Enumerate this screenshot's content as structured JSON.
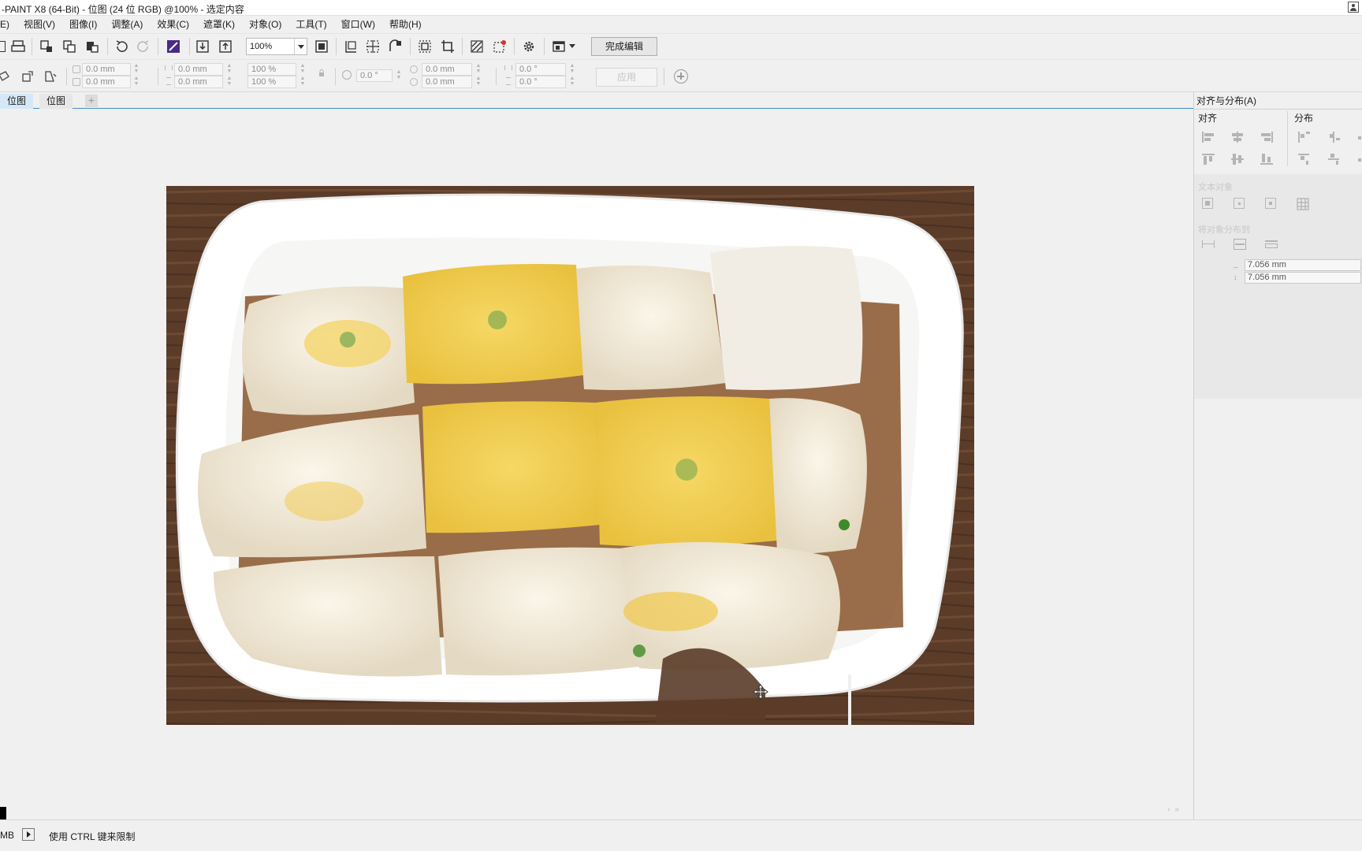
{
  "window": {
    "title": "-PAINT X8 (64-Bit) - 位图 (24 位 RGB) @100% - 选定内容"
  },
  "menu": [
    {
      "label": "E)"
    },
    {
      "label": "视图(V)"
    },
    {
      "label": "图像(I)"
    },
    {
      "label": "调整(A)"
    },
    {
      "label": "效果(C)"
    },
    {
      "label": "遮罩(K)"
    },
    {
      "label": "对象(O)"
    },
    {
      "label": "工具(T)"
    },
    {
      "label": "窗口(W)"
    },
    {
      "label": "帮助(H)"
    }
  ],
  "toolbar": {
    "zoom_value": "100%",
    "finish_edit_label": "完成编辑"
  },
  "property_bar": {
    "pos_x": "0.0 mm",
    "pos_y": "0.0 mm",
    "width": "0.0 mm",
    "height": "0.0 mm",
    "scale_x": "100 %",
    "scale_y": "100 %",
    "rotation": "0.0 °",
    "center_x": "0.0 mm",
    "center_y": "0.0 mm",
    "skew_h": "0.0 °",
    "skew_v": "0.0 °",
    "apply_label": "应用"
  },
  "doc_tabs": [
    {
      "label": "位图",
      "active": true
    },
    {
      "label": "位图",
      "active": false
    }
  ],
  "docker": {
    "title": "对齐与分布(A)",
    "align_label": "对齐",
    "distribute_label": "分布",
    "section1_title": "文本对象",
    "section2_title": "将对象分布到",
    "spacing_h": "7.056 mm",
    "spacing_v": "7.056 mm"
  },
  "status": {
    "size_text": "MB",
    "message": "使用 CTRL 键来限制"
  },
  "image": {
    "subject": "steamed rice noodle rolls on white plate",
    "colors": {
      "table": "#5e3f2c",
      "plate": "#ffffff",
      "roll": "#f3ead6",
      "egg": "#f2cf56",
      "scallion": "#5f9e4a",
      "sauce": "#7a3f12"
    }
  }
}
